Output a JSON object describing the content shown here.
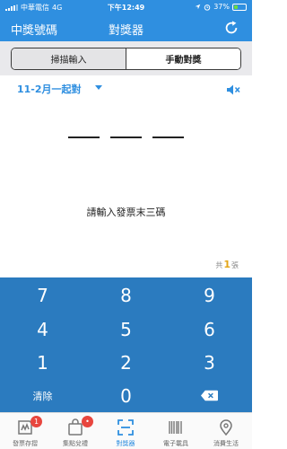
{
  "status_bar": {
    "carrier": "中華電信",
    "network": "4G",
    "time": "下午12:49",
    "battery": "37%",
    "battery_level": 0.37
  },
  "nav": {
    "left_title": "中獎號碼",
    "title": "對獎器"
  },
  "segment": {
    "scan_label": "掃描輸入",
    "manual_label": "手動對獎"
  },
  "period": {
    "label": "11-2月一起對"
  },
  "prompt": "請輸入發票末三碼",
  "counter": {
    "prefix": "共",
    "count": "1",
    "suffix": "張"
  },
  "keypad": {
    "keys": [
      "7",
      "8",
      "9",
      "4",
      "5",
      "6",
      "1",
      "2",
      "3"
    ],
    "clear_label": "清除",
    "zero_label": "0"
  },
  "tabs": [
    {
      "label": "發票存摺",
      "icon": "receipt-book-icon",
      "badge": "1"
    },
    {
      "label": "集點兌禮",
      "icon": "gift-bag-icon",
      "badge": "•"
    },
    {
      "label": "對獎器",
      "icon": "scanner-icon",
      "badge": ""
    },
    {
      "label": "電子載具",
      "icon": "barcode-icon",
      "badge": ""
    },
    {
      "label": "消費生活",
      "icon": "location-pin-icon",
      "badge": ""
    }
  ],
  "colors": {
    "primary": "#2f8fe0",
    "keypad": "#2b7bbf",
    "accent": "#e3a516",
    "badge": "#e8463e"
  }
}
